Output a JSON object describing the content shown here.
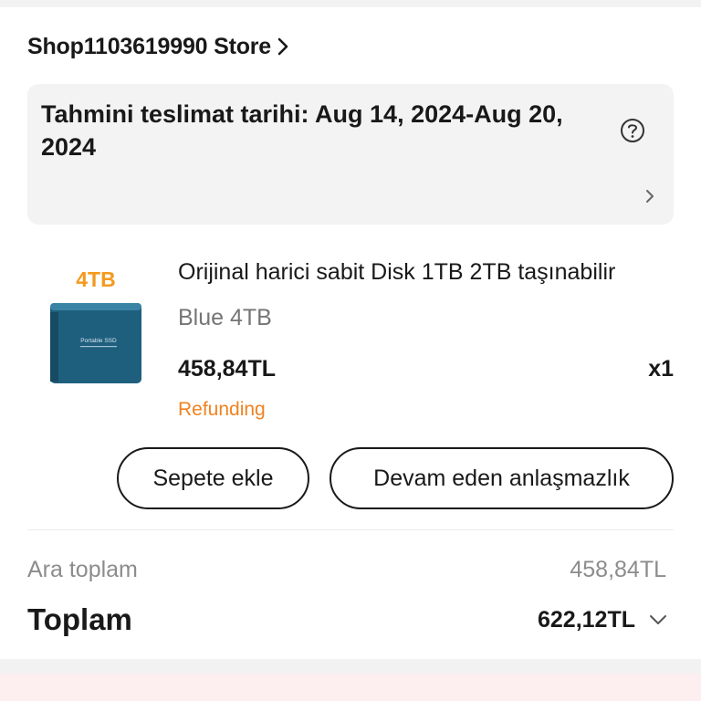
{
  "store": {
    "name": "Shop1103619990 Store",
    "chevron_icon": "chevron-right-icon"
  },
  "delivery": {
    "text": "Tahmini teslimat tarihi: Aug 14, 2024-Aug 20, 2024",
    "help_icon": "question-circle-icon",
    "chevron_icon": "chevron-right-icon"
  },
  "product": {
    "image_badge": "4TB",
    "image_text": "Portable SSD",
    "title": "Orijinal harici sabit Disk 1TB 2TB taşınabilir",
    "variant": "Blue 4TB",
    "price": "458,84TL",
    "quantity": "x1",
    "status": "Refunding"
  },
  "actions": {
    "add_to_cart": "Sepete ekle",
    "ongoing_dispute": "Devam eden anlaşmazlık"
  },
  "summary": {
    "subtotal_label": "Ara toplam",
    "subtotal_value": "458,84TL",
    "total_label": "Toplam",
    "total_value": "622,12TL",
    "total_chevron_icon": "chevron-down-icon"
  },
  "colors": {
    "status_orange": "#f08220",
    "text_primary": "#191919",
    "text_secondary": "#757575",
    "delivery_bg": "#f3f3f3",
    "bottom_strip_bg": "#fdeef0",
    "ssd_blue": "#1f5f7e"
  }
}
